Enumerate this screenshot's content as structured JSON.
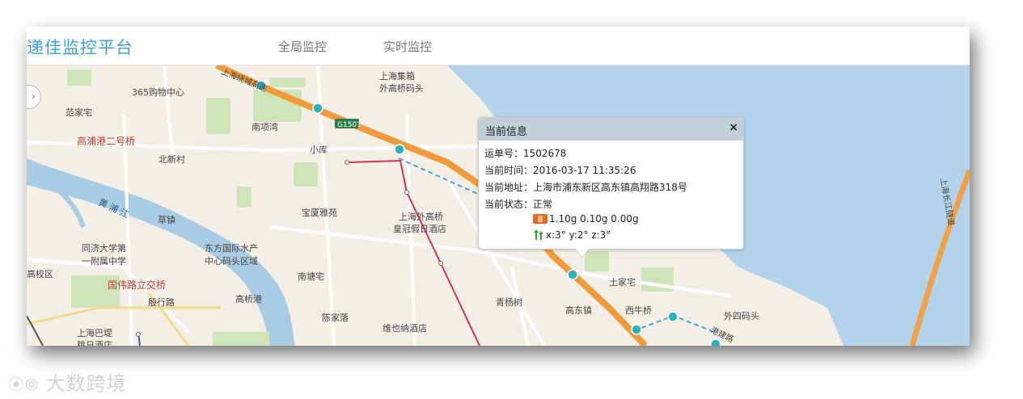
{
  "app": {
    "title": "递佳监控平台",
    "nav": [
      {
        "label": "全局监控"
      },
      {
        "label": "实时监控"
      }
    ]
  },
  "popup": {
    "title": "当前信息",
    "close": "×",
    "waybill": "运单号：1502678",
    "time": "当前时间：2016-03-17 11:35:26",
    "address": "当前地址：上海市浦东新区高东镇高翔路318号",
    "status": "当前状态：正常",
    "accel": "1.10g  0.10g  0.00g",
    "tilt": "x:3°  y:2°  z:3°"
  },
  "map": {
    "labels": {
      "mall": "365购物中心",
      "fanjiazhai": "范家宅",
      "gaopu_bridge": "高浦港二号桥",
      "beixincun": "北新村",
      "huangpu": "黄 浦 江",
      "caozhen": "草镇",
      "tongji": "同济大学第",
      "tongji2": "一附属中学",
      "dongfang": "东方国际水产",
      "dongfang2": "中心码头区域",
      "school": "高校区",
      "guowei": "国伟路立交桥",
      "yinhang": "殷行路",
      "gaoqiao_port": "高桥港",
      "shanghai_pier": "上海巴堤",
      "shanghai_pier2": "跳日酒店",
      "nanxiangwan": "南项湾",
      "xiaoku": "小库",
      "baoxia": "宝厦雅苑",
      "waigaoqiao_hotel": "上海外高桥",
      "waigaoqiao_hotel2": "皇冠假日酒店",
      "nantangzhai": "南塘宅",
      "chenjialuo": "陈家落",
      "vienna": "维也纳酒店",
      "qingyangshu": "青杨树",
      "gaodong": "高东镇",
      "xiniuqiao": "西牛桥",
      "tujiazhai": "土家宅",
      "wai4pier": "外四码头",
      "jiqiao": "上海集箱",
      "jiqiao2": "外高桥码头",
      "g1501": "G1501",
      "tunnel": "上海长江隧道",
      "harbor_road": "港建路",
      "expressway": "上海绕城高速"
    }
  },
  "watermark": "大数跨境"
}
